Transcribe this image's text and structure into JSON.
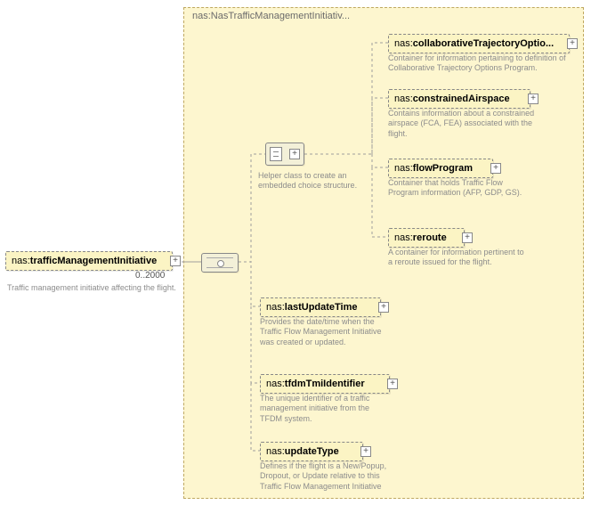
{
  "container": {
    "prefix": "nas:",
    "name": "NasTrafficManagementInitiativ..."
  },
  "root": {
    "prefix": "nas:",
    "name": "trafficManagementInitiative",
    "cardinality": "0..2000",
    "desc": "Traffic management initiative affecting the flight.",
    "expander": "+"
  },
  "helper": {
    "desc": "Helper class to create an embedded choice structure.",
    "expander": "+"
  },
  "choice": [
    {
      "prefix": "nas:",
      "name": "collaborativeTrajectoryOptio...",
      "desc": "Container for information pertaining to definition of Collaborative Trajectory Options Program.",
      "expander": "+"
    },
    {
      "prefix": "nas:",
      "name": "constrainedAirspace",
      "desc": "Contains information about a constrained airspace (FCA, FEA) associated with the flight.",
      "expander": "+"
    },
    {
      "prefix": "nas:",
      "name": "flowProgram",
      "desc": "Container that holds Traffic Flow Program information (AFP, GDP, GS).",
      "expander": "+"
    },
    {
      "prefix": "nas:",
      "name": "reroute",
      "desc": "A container for information pertinent to a reroute issued for the flight.",
      "expander": "+"
    }
  ],
  "seq": [
    {
      "prefix": "nas:",
      "name": "lastUpdateTime",
      "desc": "Provides the date/time when the Traffic Flow Management Initiative was created or updated.",
      "expander": "+"
    },
    {
      "prefix": "nas:",
      "name": "tfdmTmiIdentifier",
      "desc": "The unique identifier of a traffic management initiative from the TFDM system.",
      "expander": "+"
    },
    {
      "prefix": "nas:",
      "name": "updateType",
      "desc": "Defines if the flight is a New/Popup, Dropout, or Update relative to this Traffic Flow Management Initiative",
      "expander": "+"
    }
  ]
}
